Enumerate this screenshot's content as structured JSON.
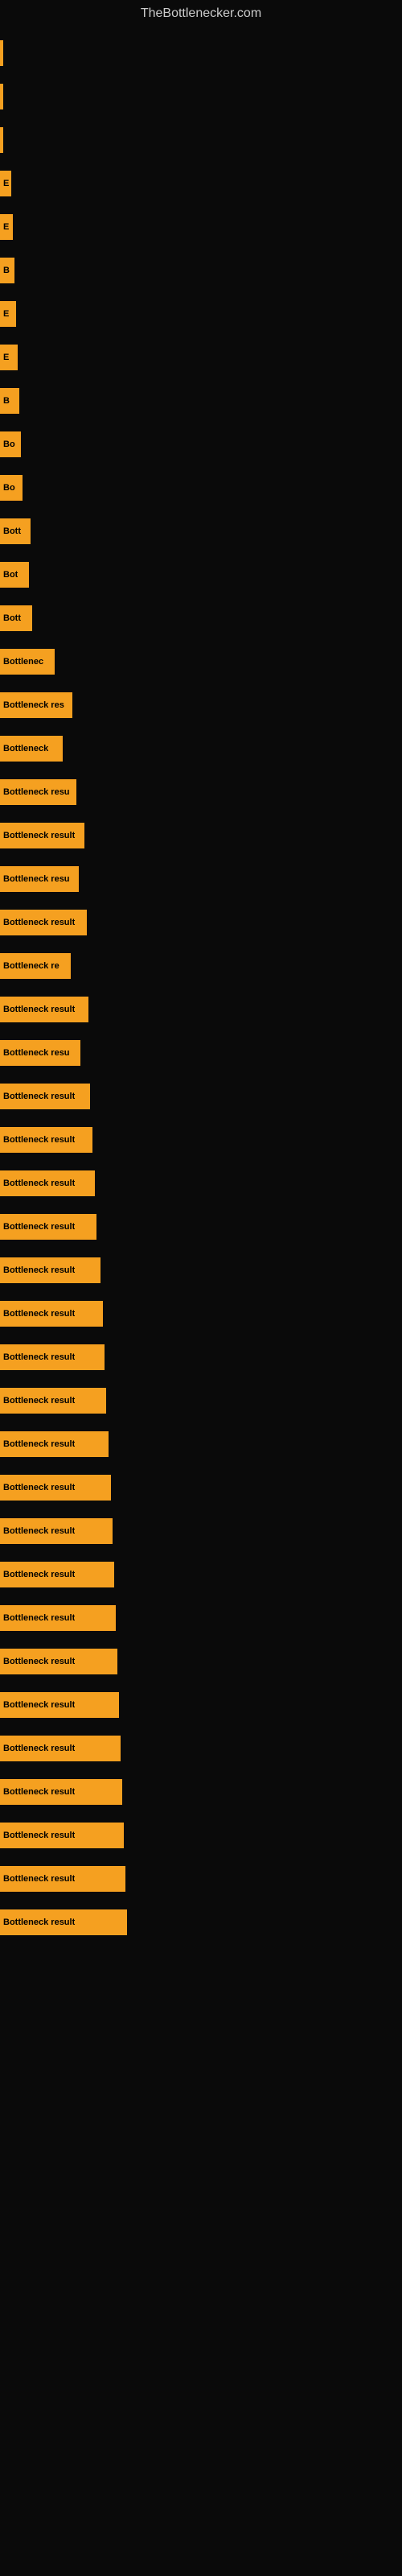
{
  "site": {
    "title": "TheBottlenecker.com"
  },
  "bars": [
    {
      "label": "",
      "width": 2
    },
    {
      "label": "",
      "width": 2
    },
    {
      "label": "",
      "width": 3
    },
    {
      "label": "E",
      "width": 14
    },
    {
      "label": "E",
      "width": 16
    },
    {
      "label": "B",
      "width": 18
    },
    {
      "label": "E",
      "width": 20
    },
    {
      "label": "E",
      "width": 22
    },
    {
      "label": "B",
      "width": 24
    },
    {
      "label": "Bo",
      "width": 26
    },
    {
      "label": "Bo",
      "width": 28
    },
    {
      "label": "Bott",
      "width": 38
    },
    {
      "label": "Bot",
      "width": 36
    },
    {
      "label": "Bott",
      "width": 40
    },
    {
      "label": "Bottlenec",
      "width": 68
    },
    {
      "label": "Bottleneck res",
      "width": 90
    },
    {
      "label": "Bottleneck",
      "width": 78
    },
    {
      "label": "Bottleneck resu",
      "width": 95
    },
    {
      "label": "Bottleneck result",
      "width": 105
    },
    {
      "label": "Bottleneck resu",
      "width": 98
    },
    {
      "label": "Bottleneck result",
      "width": 108
    },
    {
      "label": "Bottleneck re",
      "width": 88
    },
    {
      "label": "Bottleneck result",
      "width": 110
    },
    {
      "label": "Bottleneck resu",
      "width": 100
    },
    {
      "label": "Bottleneck result",
      "width": 112
    },
    {
      "label": "Bottleneck result",
      "width": 115
    },
    {
      "label": "Bottleneck result",
      "width": 118
    },
    {
      "label": "Bottleneck result",
      "width": 120
    },
    {
      "label": "Bottleneck result",
      "width": 125
    },
    {
      "label": "Bottleneck result",
      "width": 128
    },
    {
      "label": "Bottleneck result",
      "width": 130
    },
    {
      "label": "Bottleneck result",
      "width": 132
    },
    {
      "label": "Bottleneck result",
      "width": 135
    },
    {
      "label": "Bottleneck result",
      "width": 138
    },
    {
      "label": "Bottleneck result",
      "width": 140
    },
    {
      "label": "Bottleneck result",
      "width": 142
    },
    {
      "label": "Bottleneck result",
      "width": 144
    },
    {
      "label": "Bottleneck result",
      "width": 146
    },
    {
      "label": "Bottleneck result",
      "width": 148
    },
    {
      "label": "Bottleneck result",
      "width": 150
    },
    {
      "label": "Bottleneck result",
      "width": 152
    },
    {
      "label": "Bottleneck result",
      "width": 154
    },
    {
      "label": "Bottleneck result",
      "width": 156
    },
    {
      "label": "Bottleneck result",
      "width": 158
    }
  ]
}
